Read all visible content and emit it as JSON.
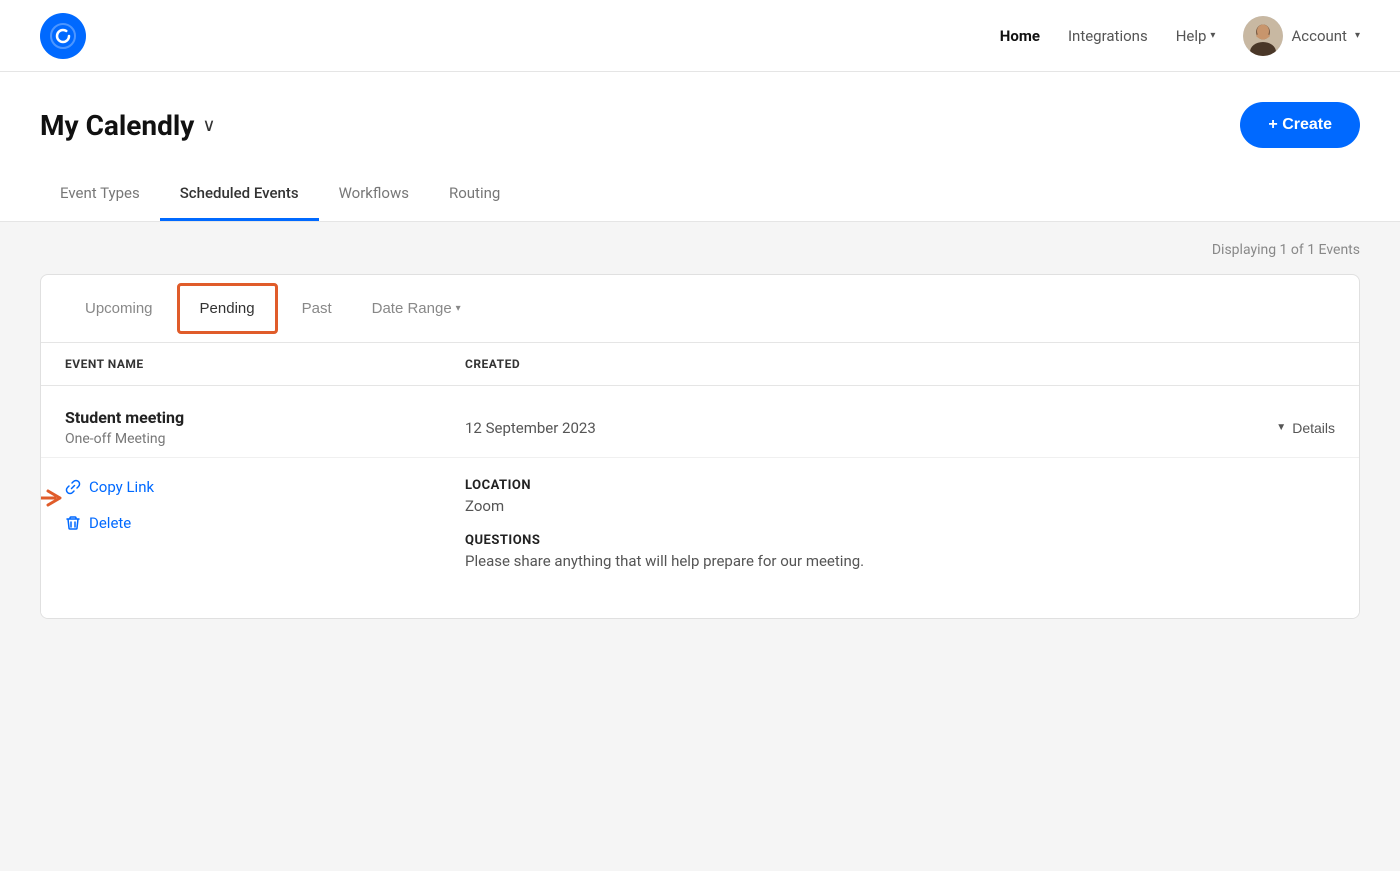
{
  "header": {
    "logo_letter": "C",
    "nav": {
      "home": "Home",
      "integrations": "Integrations",
      "help": "Help",
      "account": "Account"
    }
  },
  "page": {
    "title": "My Calendly",
    "create_button": "+ Create"
  },
  "tabs": [
    {
      "id": "event-types",
      "label": "Event Types",
      "active": false
    },
    {
      "id": "scheduled-events",
      "label": "Scheduled Events",
      "active": true
    },
    {
      "id": "workflows",
      "label": "Workflows",
      "active": false
    },
    {
      "id": "routing",
      "label": "Routing",
      "active": false
    }
  ],
  "filter": {
    "displaying": "Displaying 1 of 1 Events",
    "tabs": [
      {
        "id": "upcoming",
        "label": "Upcoming",
        "active": false
      },
      {
        "id": "pending",
        "label": "Pending",
        "active": true
      },
      {
        "id": "past",
        "label": "Past",
        "active": false
      },
      {
        "id": "date-range",
        "label": "Date Range",
        "active": false
      }
    ]
  },
  "table": {
    "col_event_name": "EVENT NAME",
    "col_created": "CREATED"
  },
  "events": [
    {
      "name": "Student meeting",
      "subtype": "One-off Meeting",
      "created": "12 September 2023",
      "details_label": "Details",
      "location_label": "LOCATION",
      "location_value": "Zoom",
      "questions_label": "QUESTIONS",
      "questions_value": "Please share anything that will help prepare for our meeting.",
      "copy_link_label": "Copy Link",
      "delete_label": "Delete"
    }
  ]
}
